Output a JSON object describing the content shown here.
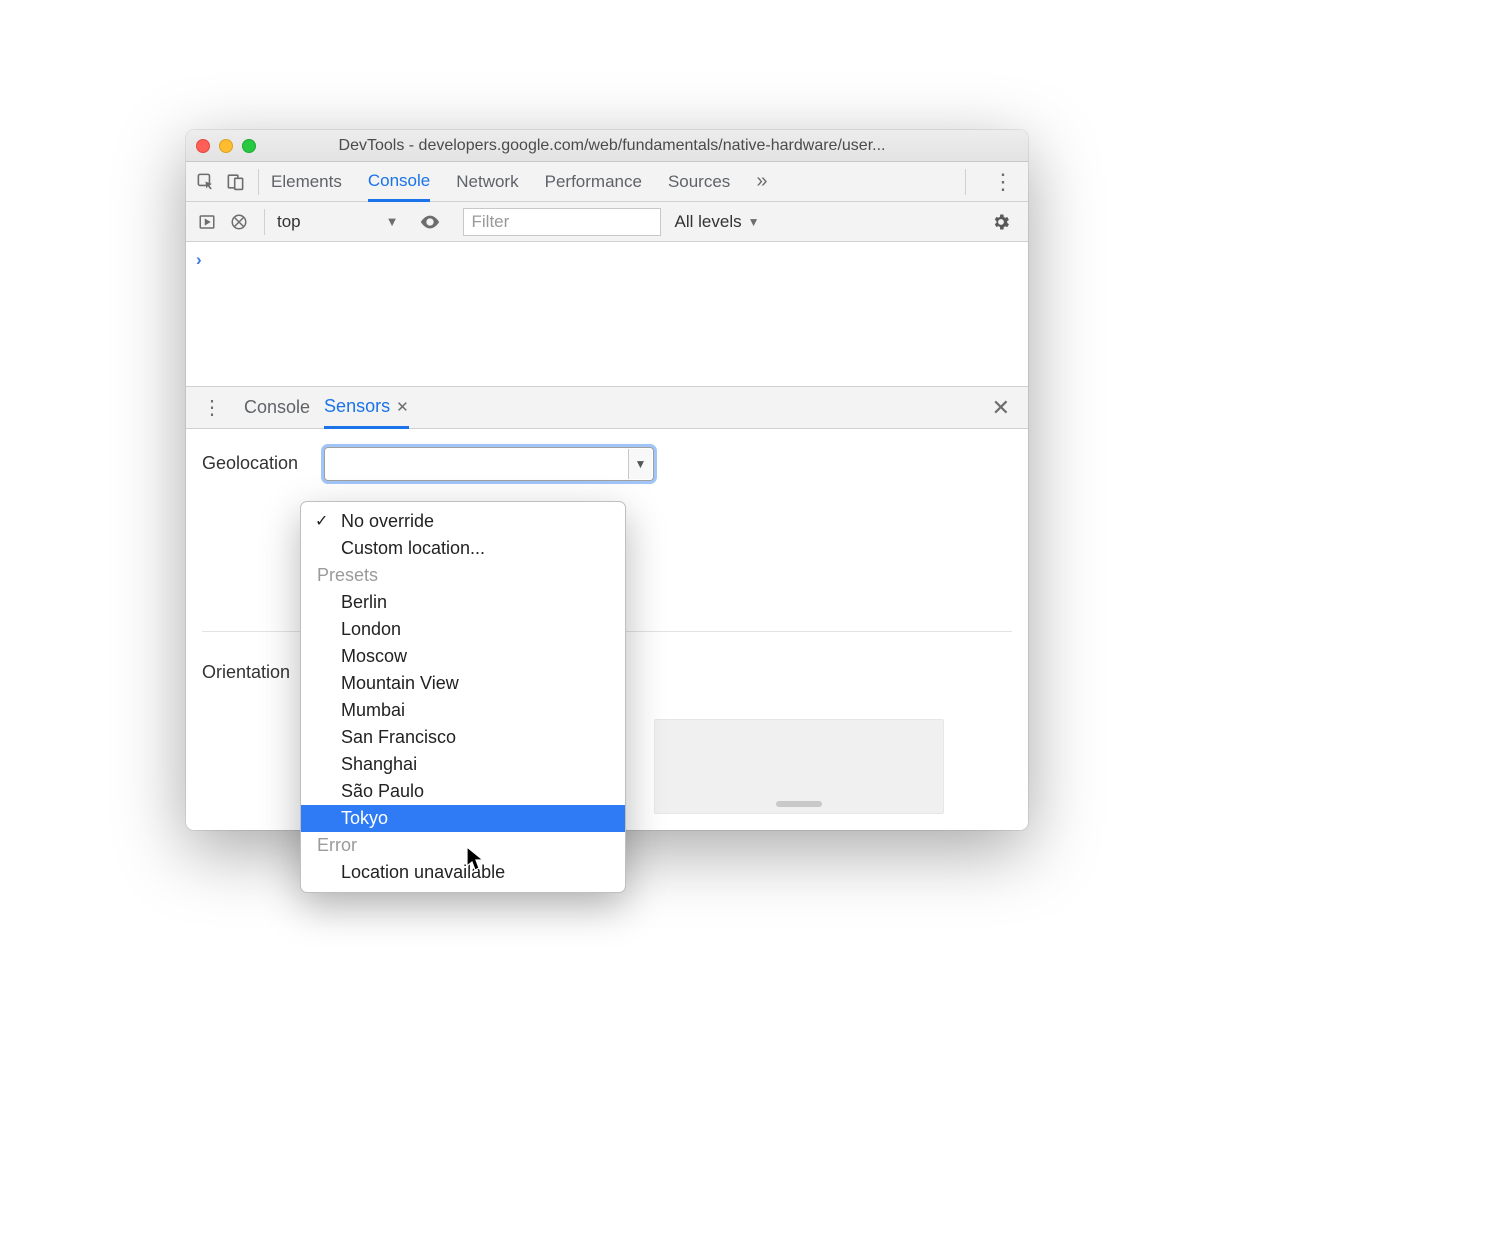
{
  "window": {
    "title": "DevTools - developers.google.com/web/fundamentals/native-hardware/user..."
  },
  "mainTabs": {
    "t0": "Elements",
    "t1": "Console",
    "t2": "Network",
    "t3": "Performance",
    "t4": "Sources"
  },
  "filterbar": {
    "context": "top",
    "filterPlaceholder": "Filter",
    "levels": "All levels"
  },
  "console": {
    "prompt": "›"
  },
  "drawerTabs": {
    "t0": "Console",
    "t1": "Sensors"
  },
  "sensors": {
    "geolocationLabel": "Geolocation",
    "orientationLabel": "Orientation"
  },
  "geolocationDropdown": {
    "o0": "No override",
    "o1": "Custom location...",
    "g1": "Presets",
    "o2": "Berlin",
    "o3": "London",
    "o4": "Moscow",
    "o5": "Mountain View",
    "o6": "Mumbai",
    "o7": "San Francisco",
    "o8": "Shanghai",
    "o9": "São Paulo",
    "o10": "Tokyo",
    "g2": "Error",
    "o11": "Location unavailable"
  }
}
